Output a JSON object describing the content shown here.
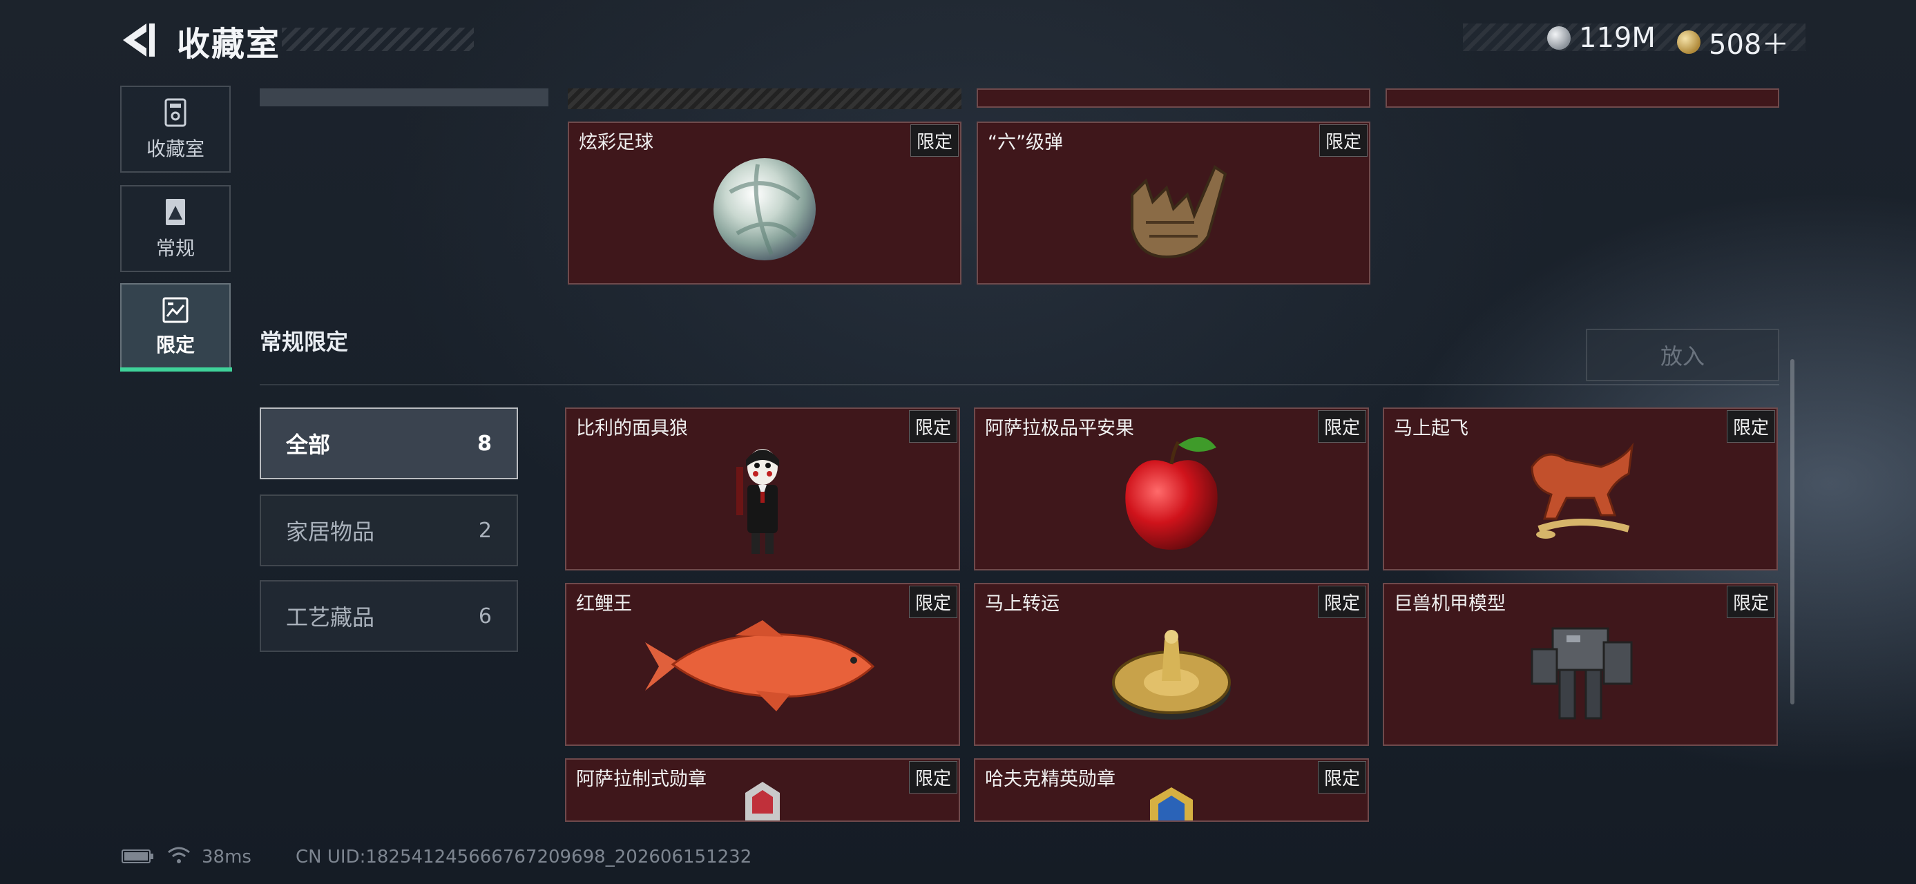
{
  "header": {
    "title": "收藏室",
    "currency": [
      {
        "icon": "silver-coin-icon",
        "value": "119M"
      },
      {
        "icon": "gold-coin-icon",
        "value": "508＋"
      }
    ]
  },
  "nav": [
    {
      "label": "收藏室",
      "icon": "collection-icon"
    },
    {
      "label": "常规",
      "icon": "regular-icon"
    },
    {
      "label": "限定",
      "icon": "limited-icon",
      "active": true
    }
  ],
  "top_cards": [
    {
      "name": "炫彩足球",
      "badge": "限定",
      "art": "soccer-ball"
    },
    {
      "name": "“六”级弹",
      "badge": "限定",
      "art": "shaka-hand"
    }
  ],
  "section": {
    "title": "常规限定",
    "put_button": "放入"
  },
  "filters": [
    {
      "label": "全部",
      "count": "8",
      "active": true
    },
    {
      "label": "家居物品",
      "count": "2"
    },
    {
      "label": "工艺藏品",
      "count": "6"
    }
  ],
  "items": [
    {
      "name": "比利的面具狼",
      "badge": "限定",
      "art": "puppet"
    },
    {
      "name": "阿萨拉极品平安果",
      "badge": "限定",
      "art": "apple"
    },
    {
      "name": "马上起飞",
      "badge": "限定",
      "art": "horse"
    },
    {
      "name": "红鲤王",
      "badge": "限定",
      "art": "carp"
    },
    {
      "name": "马上转运",
      "badge": "限定",
      "art": "spinner"
    },
    {
      "name": "巨兽机甲模型",
      "badge": "限定",
      "art": "mech"
    },
    {
      "name": "阿萨拉制式勋章",
      "badge": "限定",
      "art": "medal-red"
    },
    {
      "name": "哈夫克精英勋章",
      "badge": "限定",
      "art": "medal-blue"
    }
  ],
  "footer": {
    "ping": "38ms",
    "uid": "CN UID:1825412456667672096​98_202606151232"
  }
}
